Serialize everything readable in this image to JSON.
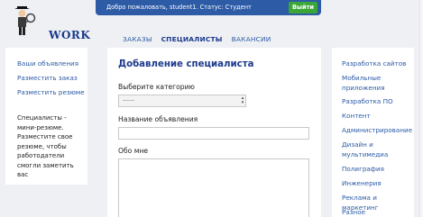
{
  "logo": {
    "text": "WORK",
    "icon": "student-with-magnifier-icon"
  },
  "topbar": {
    "welcome_text": "Добро пожаловать, student1. Статус: Студент",
    "logout_label": "Выйти",
    "bg_color": "#2d5ba6",
    "logout_color": "#3aa637"
  },
  "nav": {
    "tabs": [
      {
        "label": "ЗАКАЗЫ",
        "active": false
      },
      {
        "label": "СПЕЦИАЛИСТЫ",
        "active": true
      },
      {
        "label": "ВАКАНСИИ",
        "active": false
      }
    ]
  },
  "left_sidebar": {
    "links": [
      "Ваши объявления",
      "Разместить заказ",
      "Разместить резюме"
    ],
    "note": "Специалисты - мини-резюме. Разместите свое резюме, чтобы работодатели смогли заметить вас"
  },
  "form": {
    "title": "Добавление специалиста",
    "category_label": "Выберите категорию",
    "category_value": "------",
    "title_label": "Название объявления",
    "about_label": "Обо мне"
  },
  "right_sidebar": {
    "categories": [
      "Разработка сайтов",
      "Мобильные приложения",
      "Разработка ПО",
      "Контент",
      "Администрирование",
      "Дизайн и мультимедиа",
      "Полиграфия",
      "Инженерия",
      "Реклама и маркетинг",
      "Разное"
    ]
  }
}
